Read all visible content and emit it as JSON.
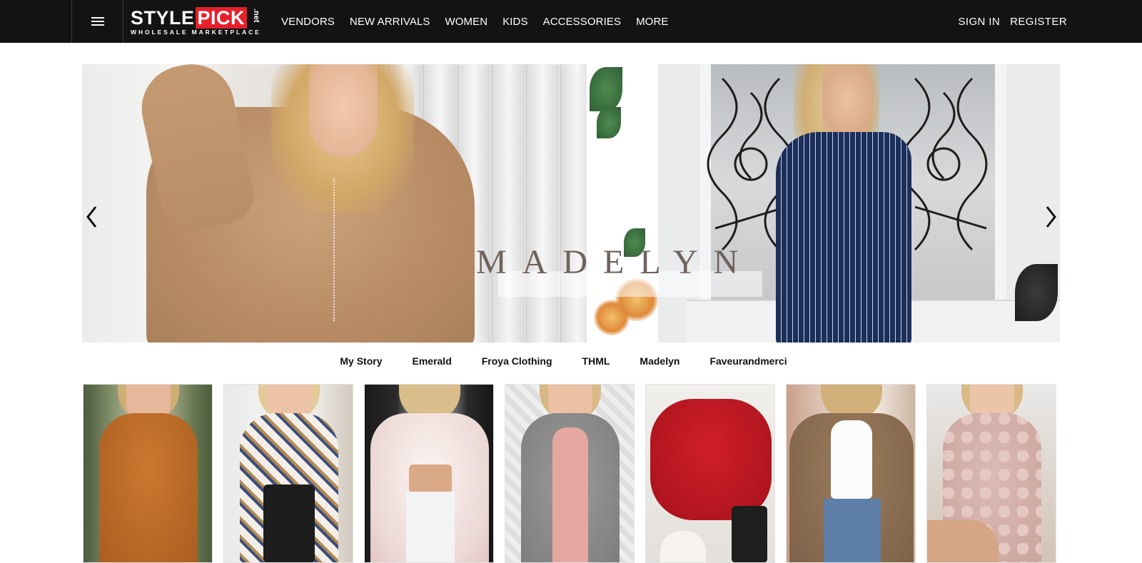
{
  "header": {
    "menu_icon": "hamburger-menu-icon",
    "logo": {
      "brand_part1": "STYLE",
      "brand_part2": "PICK",
      "suffix": ".net",
      "tagline": "WHOLESALE MARKETPLACE",
      "accent_color": "#e5202b"
    },
    "nav": [
      "VENDORS",
      "NEW ARRIVALS",
      "WOMEN",
      "KIDS",
      "ACCESSORIES",
      "MORE"
    ],
    "auth": {
      "sign_in": "SIGN IN",
      "register": "REGISTER"
    },
    "background_color": "#131313"
  },
  "banner": {
    "wordmark": "MADELYN",
    "prev_icon": "chevron-left-icon",
    "next_icon": "chevron-right-icon"
  },
  "vendor_tabs": [
    "My Story",
    "Emerald",
    "Froya Clothing",
    "THML",
    "Madelyn",
    "Faveurandmerci"
  ],
  "products": [
    {
      "name": "rust-suede-lace-dress"
    },
    {
      "name": "aztec-print-cardigan"
    },
    {
      "name": "faux-fur-jacket"
    },
    {
      "name": "grey-knit-cardigan-pink-dress"
    },
    {
      "name": "red-turtleneck-sweater"
    },
    {
      "name": "khaki-long-cardigan"
    },
    {
      "name": "pink-pom-cardigan"
    }
  ]
}
